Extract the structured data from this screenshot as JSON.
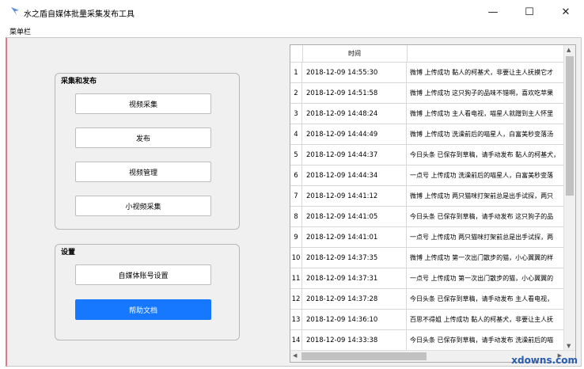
{
  "window": {
    "title": "水之盾自媒体批量采集发布工具",
    "minimize": "—",
    "maximize": "☐",
    "close": "✕"
  },
  "menu": {
    "label": "菜单栏"
  },
  "collect_group": {
    "title": "采集和发布",
    "buttons": [
      "视频采集",
      "发布",
      "视频管理",
      "小视频采集"
    ]
  },
  "settings_group": {
    "title": "设置",
    "account_button": "自媒体账号设置",
    "help_button": "帮助文档"
  },
  "table": {
    "column_time": "时间",
    "rows": [
      {
        "n": "1",
        "time": "2018-12-09 14:55:30",
        "msg": "微博 上传成功 黏人的柯基犬，非要让主人抚摸它才"
      },
      {
        "n": "2",
        "time": "2018-12-09 14:51:58",
        "msg": "微博 上传成功 这只狗子的品味不错啊，喜欢吃苹果"
      },
      {
        "n": "3",
        "time": "2018-12-09 14:48:24",
        "msg": "微博 上传成功 主人看电视，喵星人就蹭到主人怀里"
      },
      {
        "n": "4",
        "time": "2018-12-09 14:44:49",
        "msg": "微博 上传成功 洗澡前后的喵星人，白富美秒变落汤"
      },
      {
        "n": "5",
        "time": "2018-12-09 14:44:37",
        "msg": "今日头条 已保存到草稿，请手动发布 黏人的柯基犬，"
      },
      {
        "n": "6",
        "time": "2018-12-09 14:44:34",
        "msg": "一点号 上传成功 洗澡前后的喵星人，白富美秒变落"
      },
      {
        "n": "7",
        "time": "2018-12-09 14:41:12",
        "msg": "微博 上传成功 两只猫咪打架前总是出手试探，两只"
      },
      {
        "n": "8",
        "time": "2018-12-09 14:41:05",
        "msg": "今日头条 已保存到草稿，请手动发布 这只狗子的品"
      },
      {
        "n": "9",
        "time": "2018-12-09 14:41:01",
        "msg": "一点号 上传成功 两只猫咪打架前总是出手试探，两"
      },
      {
        "n": "10",
        "time": "2018-12-09 14:37:35",
        "msg": "微博 上传成功 第一次出门散步的猫，小心翼翼的样"
      },
      {
        "n": "11",
        "time": "2018-12-09 14:37:31",
        "msg": "一点号 上传成功 第一次出门散步的猫，小心翼翼的"
      },
      {
        "n": "12",
        "time": "2018-12-09 14:37:28",
        "msg": "今日头条 已保存到草稿，请手动发布 主人看电视，"
      },
      {
        "n": "13",
        "time": "2018-12-09 14:36:10",
        "msg": "百思不得姐 上传成功 黏人的柯基犬，非要让主人抚"
      },
      {
        "n": "14",
        "time": "2018-12-09 14:33:38",
        "msg": "今日头条 已保存到草稿，请手动发布 洗澡前后的喵"
      }
    ]
  },
  "watermark": "xdowns.com"
}
